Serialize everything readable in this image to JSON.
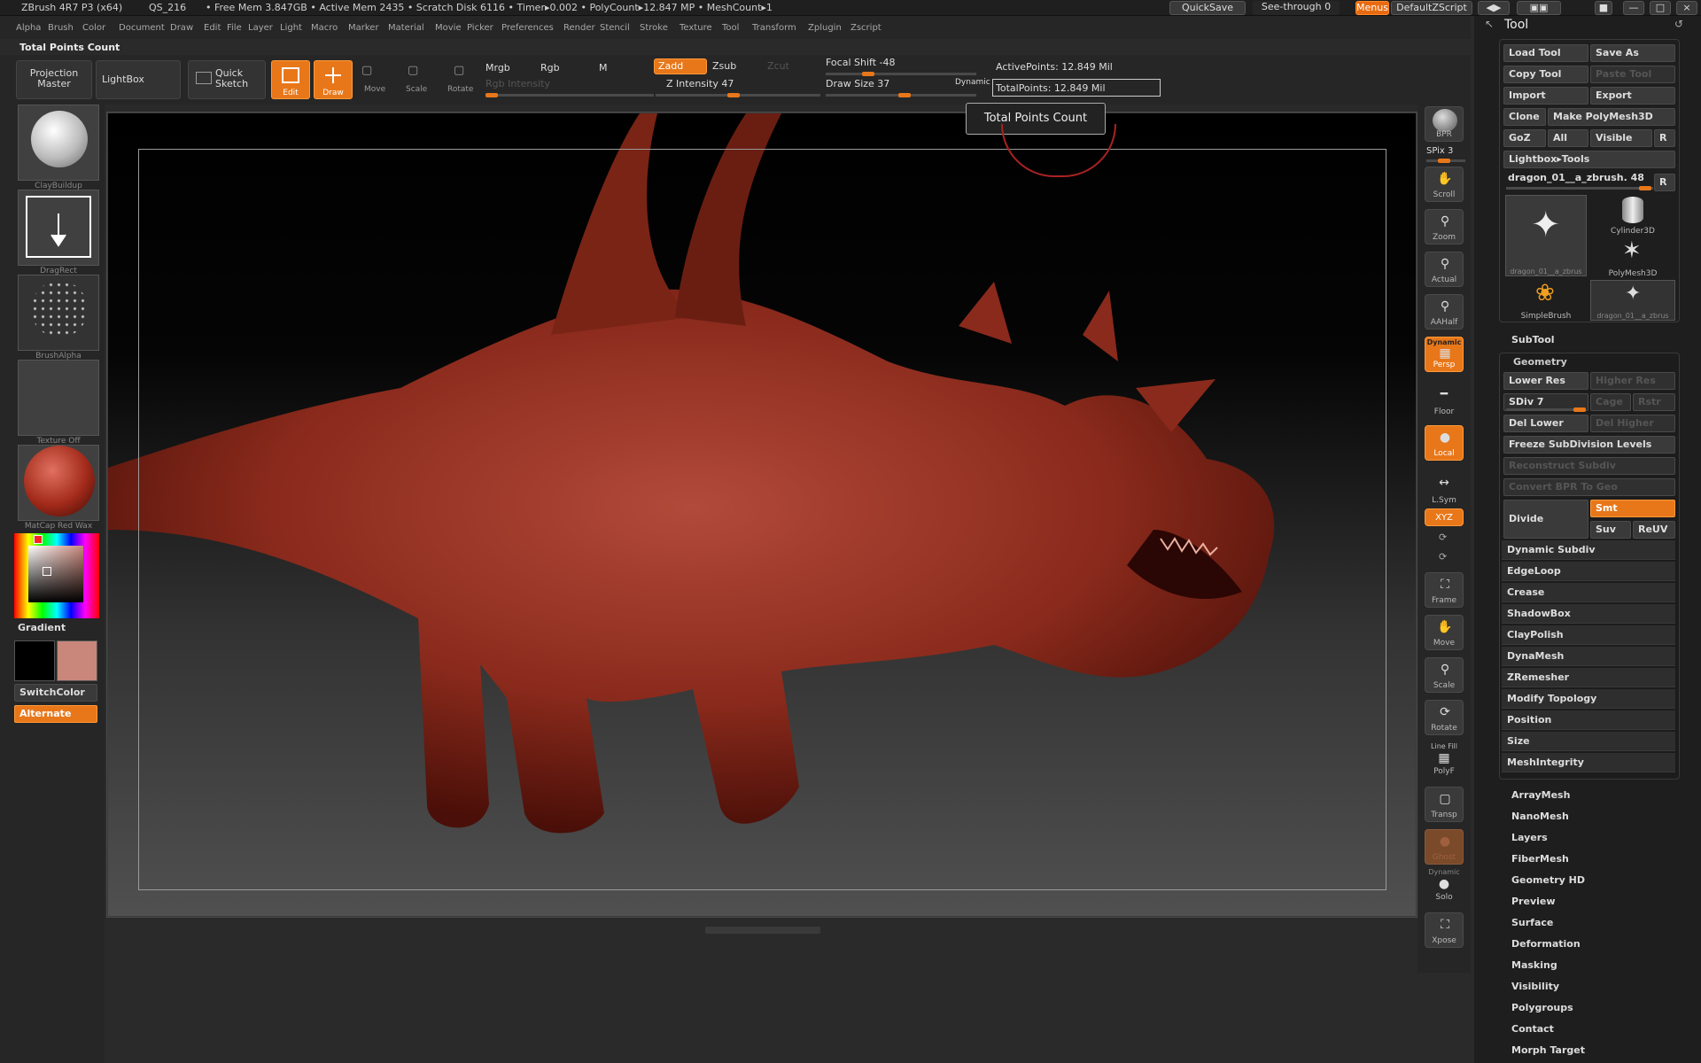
{
  "app": {
    "title": "ZBrush 4R7 P3 (x64)",
    "doc": "QS_216",
    "stats": "• Free Mem 3.847GB • Active Mem 2435 • Scratch Disk 6116 • Timer▸0.002 • PolyCount▸12.847 MP • MeshCount▸1"
  },
  "topright": {
    "quicksave": "QuickSave",
    "seethrough": "See-through  0",
    "menus": "Menus",
    "script": "DefaultZScript"
  },
  "menu": [
    "Alpha",
    "Brush",
    "Color",
    "Document",
    "Draw",
    "Edit",
    "File",
    "Layer",
    "Light",
    "Macro",
    "Marker",
    "Material",
    "Movie",
    "Picker",
    "Preferences",
    "Render",
    "Stencil",
    "Stroke",
    "Texture",
    "Tool",
    "Transform",
    "Zplugin",
    "Zscript"
  ],
  "hint": "Total Points Count",
  "toolbar": {
    "projection": "Projection Master",
    "lightbox": "LightBox",
    "quicksketch": "Quick Sketch",
    "edit": "Edit",
    "draw": "Draw",
    "move": "Move",
    "scale": "Scale",
    "rotate": "Rotate",
    "mrgb": "Mrgb",
    "rgb": "Rgb",
    "m": "M",
    "rgb_intensity": "Rgb Intensity",
    "zadd": "Zadd",
    "zsub": "Zsub",
    "zcut": "Zcut",
    "z_intensity": "Z Intensity 47",
    "focal_shift": "Focal Shift -48",
    "draw_size": "Draw Size 37",
    "dynamic": "Dynamic",
    "active_points": "ActivePoints: 12.849  Mil",
    "total_points": "TotalPoints: 12.849  Mil",
    "tooltip": "Total Points Count"
  },
  "levels": {
    "rgb_intensity": 0.0,
    "z_intensity": 0.47,
    "focal_shift": -48,
    "draw_size": 37,
    "spix": 3
  },
  "left": {
    "brush": "ClayBuildup",
    "stroke": "DragRect",
    "alpha": "BrushAlpha",
    "texture": "Texture Off",
    "material": "MatCap Red Wax",
    "gradient": "Gradient",
    "switchcolor": "SwitchColor",
    "alternate": "Alternate"
  },
  "right_strip": {
    "bpr": "BPR",
    "spix": "SPix 3",
    "scroll": "Scroll",
    "zoom": "Zoom",
    "actual": "Actual",
    "aahalf": "AAHalf",
    "dynamic": "Dynamic",
    "persp": "Persp",
    "floor": "Floor",
    "local": "Local",
    "lsym": "L.Sym",
    "xyz": "XYZ",
    "frame": "Frame",
    "move": "Move",
    "scale": "Scale",
    "rotate": "Rotate",
    "linefill": "Line Fill",
    "polyf": "PolyF",
    "transp": "Transp",
    "ghost": "Ghost",
    "dynamic2": "Dynamic",
    "solo": "Solo",
    "xpose": "Xpose"
  },
  "tool": {
    "title": "Tool",
    "load": "Load Tool",
    "saveas": "Save As",
    "copy": "Copy Tool",
    "paste": "Paste Tool",
    "import": "Import",
    "export": "Export",
    "clone": "Clone",
    "makepoly": "Make PolyMesh3D",
    "goz": "GoZ",
    "all": "All",
    "visible": "Visible",
    "r": "R",
    "lightboxtools": "Lightbox▸Tools",
    "current": "dragon_01__a_zbrush. 48",
    "r2": "R",
    "thumbs": [
      "dragon_01__a_zbrus",
      "Cylinder3D",
      "PolyMesh3D",
      "SimpleBrush",
      "dragon_01__a_zbrus"
    ],
    "subtool": "SubTool",
    "geometry": "Geometry",
    "lowerres": "Lower Res",
    "higherres": "Higher Res",
    "sdiv": "SDiv 7",
    "cage": "Cage",
    "rstr": "Rstr",
    "dellower": "Del Lower",
    "delhigher": "Del Higher",
    "freeze": "Freeze SubDivision Levels",
    "reconstruct": "Reconstruct Subdiv",
    "convertbpr": "Convert BPR To Geo",
    "divide": "Divide",
    "smt": "Smt",
    "suv": "Suv",
    "reuv": "ReUV",
    "groups": [
      "Dynamic Subdiv",
      "EdgeLoop",
      "Crease",
      "ShadowBox",
      "ClayPolish",
      "DynaMesh",
      "ZRemesher",
      "Modify Topology",
      "Position",
      "Size",
      "MeshIntegrity"
    ],
    "sections": [
      "ArrayMesh",
      "NanoMesh",
      "Layers",
      "FiberMesh",
      "Geometry HD",
      "Preview",
      "Surface",
      "Deformation",
      "Masking",
      "Visibility",
      "Polygroups",
      "Contact",
      "Morph Target"
    ]
  }
}
